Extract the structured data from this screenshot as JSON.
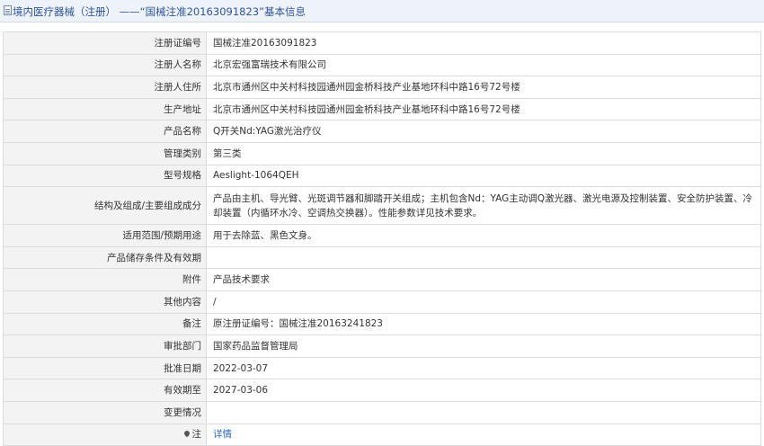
{
  "header": {
    "title": "境内医疗器械（注册） ——“国械注准20163091823”基本信息"
  },
  "rows": [
    {
      "label": "注册证编号",
      "value": "国械注准20163091823"
    },
    {
      "label": "注册人名称",
      "value": "北京宏强富瑞技术有限公司"
    },
    {
      "label": "注册人住所",
      "value": "北京市通州区中关村科技园通州园金桥科技产业基地环科中路16号72号楼"
    },
    {
      "label": "生产地址",
      "value": "北京市通州区中关村科技园通州园金桥科技产业基地环科中路16号72号楼"
    },
    {
      "label": "产品名称",
      "value": "Q开关Nd:YAG激光治疗仪"
    },
    {
      "label": "管理类别",
      "value": "第三类"
    },
    {
      "label": "型号规格",
      "value": "Aeslight-1064QEH"
    },
    {
      "label": "结构及组成/主要组成成分",
      "value": "产品由主机、导光臂、光斑调节器和脚踏开关组成；主机包含Nd：YAG主动调Q激光器、激光电源及控制装置、安全防护装置、冷却装置（内循环水冷、空调热交换器）。性能参数详见技术要求。"
    },
    {
      "label": "适用范围/预期用途",
      "value": "用于去除蓝、黑色文身。"
    },
    {
      "label": "产品储存条件及有效期",
      "value": ""
    },
    {
      "label": "附件",
      "value": "产品技术要求"
    },
    {
      "label": "其他内容",
      "value": "/"
    },
    {
      "label": "备注",
      "value": "原注册证编号：国械注准20163241823"
    },
    {
      "label": "审批部门",
      "value": "国家药品监督管理局"
    },
    {
      "label": "批准日期",
      "value": "2022-03-07"
    },
    {
      "label": "有效期至",
      "value": "2027-03-06"
    },
    {
      "label": "变更情况",
      "value": ""
    }
  ],
  "footer_row": {
    "label": "注",
    "icon": "pin-icon",
    "link_text": "详情"
  }
}
